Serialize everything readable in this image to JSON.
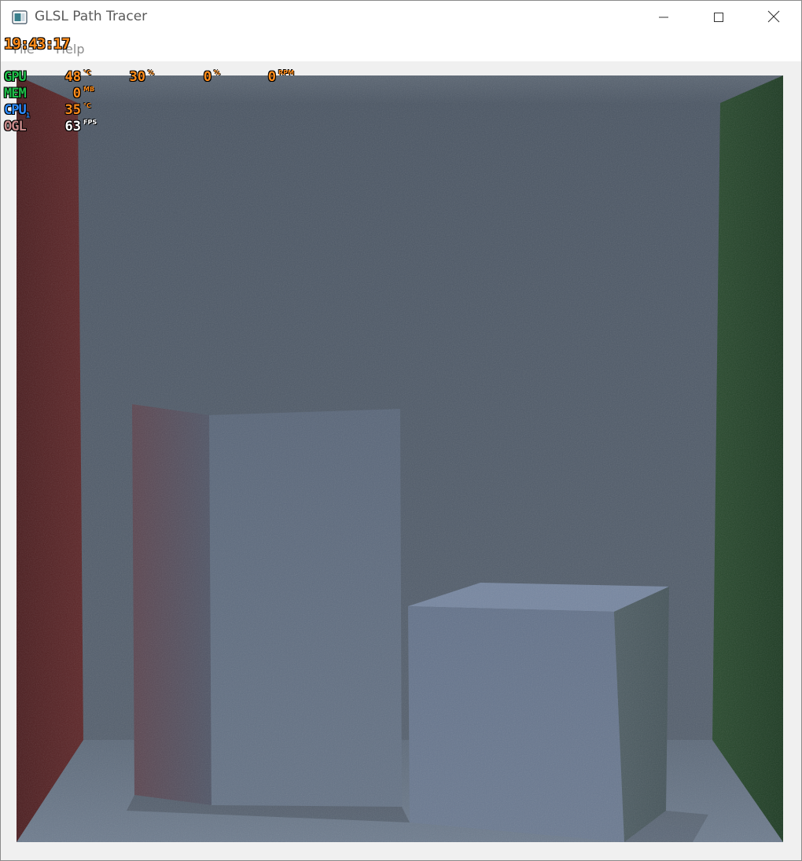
{
  "window": {
    "title": "GLSL Path Tracer",
    "app_icon": "app-window-icon",
    "controls": [
      "minimize-icon",
      "maximize-icon",
      "close-icon"
    ]
  },
  "menubar": {
    "items": [
      {
        "label": "File"
      },
      {
        "label": "Help"
      }
    ]
  },
  "overlay": {
    "clock": "19:43:17",
    "rows": [
      {
        "label": "GPU",
        "label_color": "#1fbf4a",
        "values": [
          {
            "value": "48",
            "unit": "°C"
          },
          {
            "value": "30",
            "unit": "%"
          },
          {
            "value": "0",
            "unit": "%"
          },
          {
            "value": "0",
            "unit": "RPM"
          }
        ]
      },
      {
        "label": "MEM",
        "label_color": "#1fbf4a",
        "values": [
          {
            "value": "0",
            "unit": "MB"
          }
        ]
      },
      {
        "label": "CPU",
        "label_sub": "1",
        "label_color": "#2d8cff",
        "values": [
          {
            "value": "35",
            "unit": "°C"
          }
        ]
      },
      {
        "label": "OGL",
        "label_color": "#c98a8a",
        "values": [
          {
            "value": "63",
            "unit": "FPS"
          }
        ]
      }
    ]
  },
  "scene": {
    "left_wall_color": "#5a2323",
    "right_wall_color": "#25472a",
    "back_wall_color": "#4e5966",
    "box_color": "#5f6f84"
  }
}
